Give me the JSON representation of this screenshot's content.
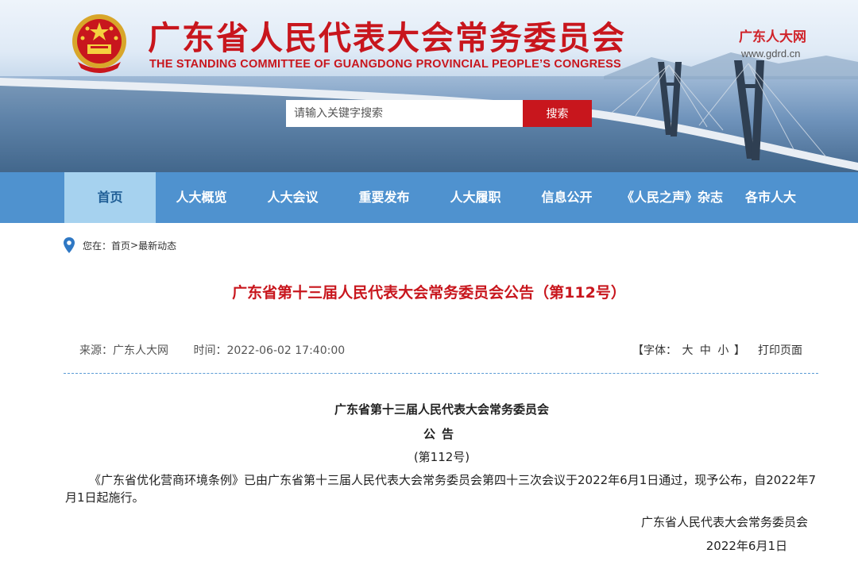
{
  "header": {
    "title": "广东省人民代表大会常务委员会",
    "subtitle": "THE STANDING COMMITTEE OF GUANGDONG PROVINCIAL PEOPLE’S CONGRESS",
    "brand_name": "广东人大网",
    "brand_url": "www.gdrd.cn",
    "search_placeholder": "请输入关键字搜索",
    "search_button": "搜索"
  },
  "nav": {
    "items": [
      {
        "label": "首页",
        "active": true
      },
      {
        "label": "人大概览"
      },
      {
        "label": "人大会议"
      },
      {
        "label": "重要发布"
      },
      {
        "label": "人大履职"
      },
      {
        "label": "信息公开"
      },
      {
        "label": "《人民之声》杂志"
      },
      {
        "label": "各市人大"
      }
    ]
  },
  "breadcrumb": {
    "prefix": "您在：",
    "home": "首页",
    "separator": ">",
    "current": "最新动态"
  },
  "article": {
    "title": "广东省第十三届人民代表大会常务委员会公告（第112号）",
    "source_label": "来源：广东人大网",
    "time_label": "时间：2022-06-02 17:40:00",
    "font_label_open": "【字体：",
    "font_large": "大",
    "font_medium": "中",
    "font_small": "小",
    "font_label_close": "】",
    "print": "打印页面",
    "org": "广东省第十三届人民代表大会常务委员会",
    "notice": "公告",
    "number": "(第112号)",
    "paragraph": "《广东省优化营商环境条例》已由广东省第十三届人民代表大会常务委员会第四十三次会议于2022年6月1日通过，现予公布，自2022年7月1日起施行。",
    "signature": "广东省人民代表大会常务委员会",
    "date": "2022年6月1日"
  },
  "colors": {
    "brand_red": "#c8161d",
    "nav_blue": "#4f92cf",
    "nav_active": "#a6d2ef",
    "divider_blue": "#5b9bd5"
  }
}
